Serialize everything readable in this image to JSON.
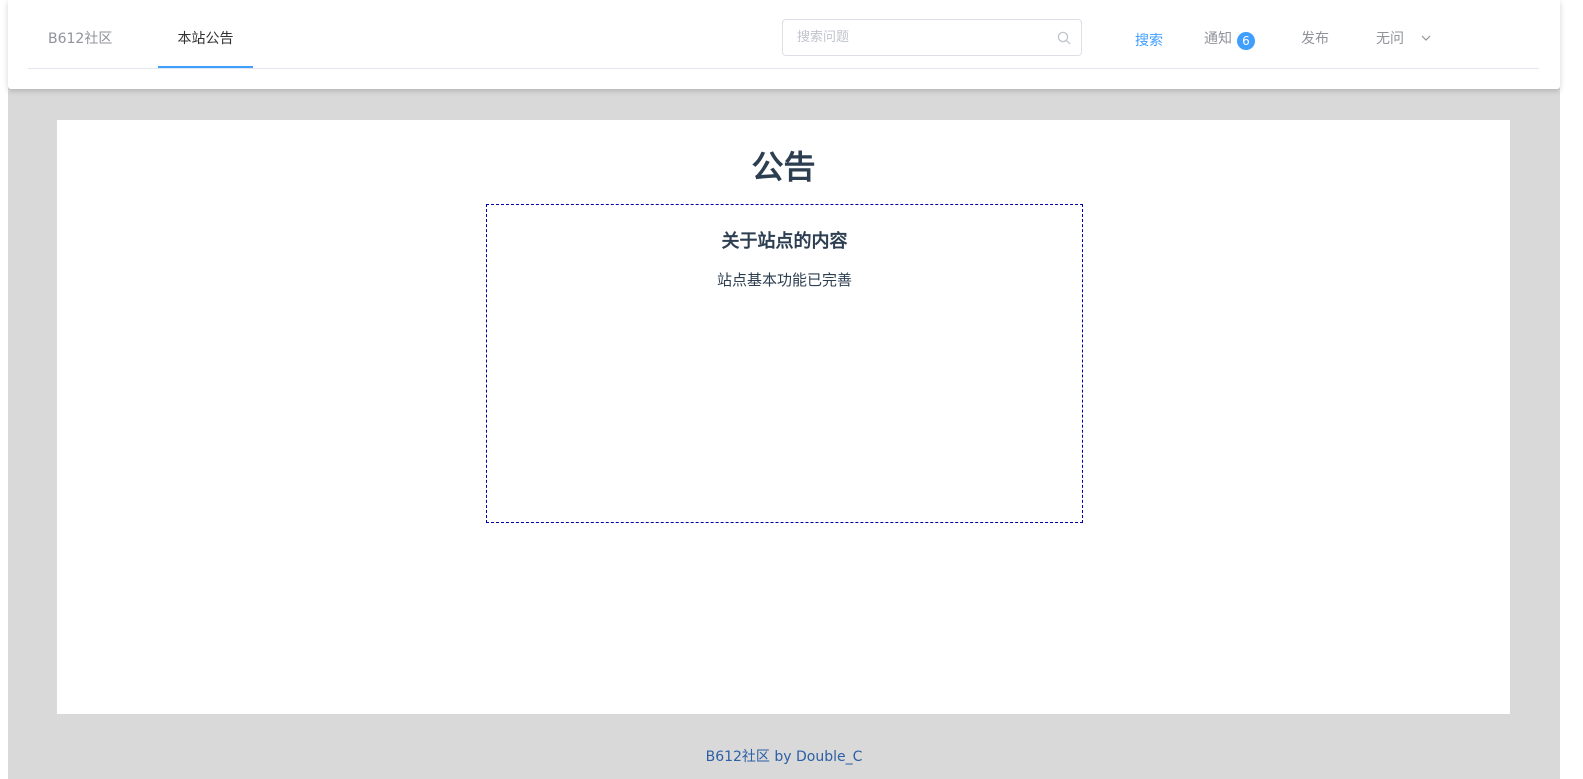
{
  "nav": {
    "brand": "B612社区",
    "active_tab": "本站公告"
  },
  "search": {
    "placeholder": "搜索问题",
    "value": "",
    "button_label": "搜索"
  },
  "menu": {
    "notify_label": "通知",
    "notify_count": "6",
    "publish_label": "发布",
    "user_label": "无问"
  },
  "main": {
    "title": "公告",
    "notice": {
      "title": "关于站点的内容",
      "body": "站点基本功能已完善"
    }
  },
  "footer": {
    "text": "B612社区 by Double_C"
  },
  "colors": {
    "accent": "#409eff",
    "background": "#d9d9d9",
    "notice_border": "#0000aa"
  }
}
